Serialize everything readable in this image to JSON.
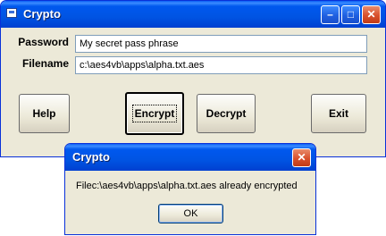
{
  "main_window": {
    "title": "Crypto",
    "password_label": "Password",
    "password_value": "My secret pass phrase",
    "filename_label": "Filename",
    "filename_value": "c:\\aes4vb\\apps\\alpha.txt.aes",
    "buttons": {
      "help": "Help",
      "encrypt": "Encrypt",
      "decrypt": "Decrypt",
      "exit": "Exit"
    },
    "caption": {
      "minimize_glyph": "–",
      "maximize_glyph": "□",
      "close_glyph": "✕"
    }
  },
  "dialog": {
    "title": "Crypto",
    "message": "Filec:\\aes4vb\\apps\\alpha.txt.aes already encrypted",
    "ok_label": "OK",
    "close_glyph": "✕"
  },
  "colors": {
    "titlebar_blue": "#0054e3",
    "window_face": "#ece9d8",
    "close_red": "#d8502c"
  }
}
